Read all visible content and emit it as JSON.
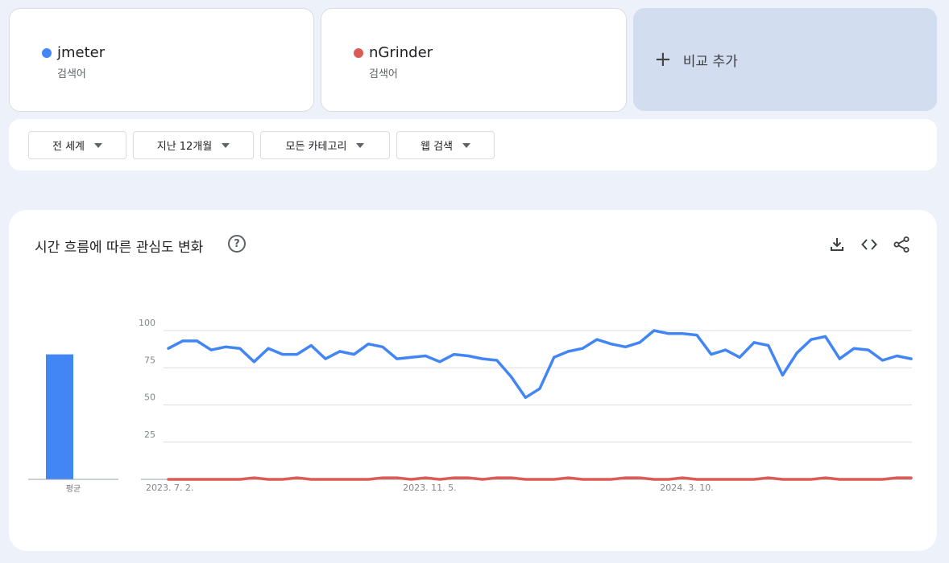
{
  "terms": [
    {
      "name": "jmeter",
      "type": "검색어",
      "color": "#4285f4"
    },
    {
      "name": "nGrinder",
      "type": "검색어",
      "color": "#db5b56"
    }
  ],
  "add_compare_label": "비교 추가",
  "filters": [
    "전 세계",
    "지난 12개월",
    "모든 카테고리",
    "웹 검색"
  ],
  "chart_title": "시간 흐름에 따른 관심도 변화",
  "help_glyph": "?",
  "chart_data": {
    "type": "line",
    "average_bar": {
      "label": "평균",
      "values": [
        84,
        0
      ]
    },
    "ylim": [
      0,
      100
    ],
    "y_ticks": [
      25,
      50,
      75,
      100
    ],
    "x_tick_labels": [
      {
        "label": "2023. 7. 2.",
        "index": 0
      },
      {
        "label": "2023. 11. 5.",
        "index": 18
      },
      {
        "label": "2024. 3. 10.",
        "index": 36
      }
    ],
    "grid": true,
    "series": [
      {
        "name": "jmeter",
        "color": "#4285f4",
        "values": [
          88,
          93,
          93,
          87,
          89,
          88,
          79,
          88,
          84,
          84,
          90,
          81,
          86,
          84,
          91,
          89,
          81,
          82,
          83,
          79,
          84,
          83,
          81,
          80,
          69,
          55,
          61,
          82,
          86,
          88,
          94,
          91,
          89,
          92,
          100,
          98,
          98,
          97,
          84,
          87,
          82,
          92,
          90,
          70,
          85,
          94,
          96,
          81,
          88,
          87,
          80,
          83,
          81
        ]
      },
      {
        "name": "nGrinder",
        "color": "#db5b56",
        "values": [
          0,
          0,
          0,
          0,
          0,
          0,
          1,
          0,
          0,
          1,
          0,
          0,
          0,
          0,
          0,
          1,
          1,
          0,
          1,
          0,
          1,
          1,
          0,
          1,
          1,
          0,
          0,
          0,
          1,
          0,
          0,
          0,
          1,
          1,
          0,
          0,
          1,
          0,
          0,
          0,
          0,
          0,
          1,
          0,
          0,
          0,
          1,
          0,
          0,
          0,
          0,
          1,
          1
        ]
      }
    ]
  }
}
